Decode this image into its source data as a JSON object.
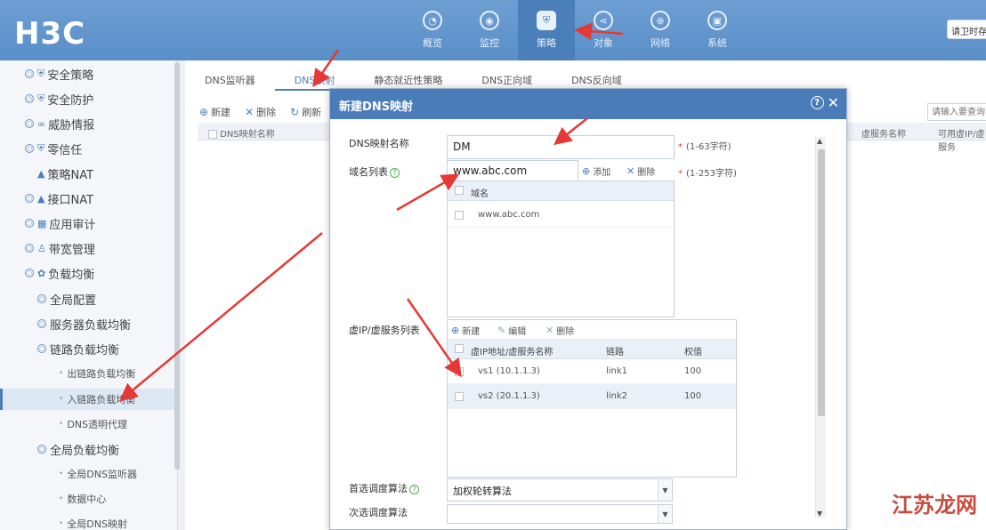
{
  "header": {
    "logo": "H3C",
    "nav": [
      {
        "label": "概览",
        "icon": "dashboard-icon",
        "glyph": "◔"
      },
      {
        "label": "监控",
        "icon": "monitor-icon",
        "glyph": "◉"
      },
      {
        "label": "策略",
        "icon": "shield-icon",
        "glyph": "⛨",
        "active": true
      },
      {
        "label": "对象",
        "icon": "share-icon",
        "glyph": "⋖"
      },
      {
        "label": "网络",
        "icon": "globe-icon",
        "glyph": "⊕"
      },
      {
        "label": "系统",
        "icon": "system-icon",
        "glyph": "▣"
      }
    ],
    "user_text": "请卫时存"
  },
  "sidebar": {
    "items": [
      {
        "label": "安全策略",
        "level": 0,
        "glyph": "⛨"
      },
      {
        "label": "安全防护",
        "level": 0,
        "glyph": "⛨"
      },
      {
        "label": "威胁情报",
        "level": 0,
        "glyph": "∞"
      },
      {
        "label": "零信任",
        "level": 0,
        "glyph": "⛨"
      },
      {
        "label": "策略NAT",
        "level": 1,
        "glyph": "▲"
      },
      {
        "label": "接口NAT",
        "level": 0,
        "glyph": "▲"
      },
      {
        "label": "应用审计",
        "level": 0,
        "glyph": "▦"
      },
      {
        "label": "带宽管理",
        "level": 0,
        "glyph": "♙"
      },
      {
        "label": "负载均衡",
        "level": 0,
        "glyph": "✿"
      },
      {
        "label": "全局配置",
        "level": 1
      },
      {
        "label": "服务器负载均衡",
        "level": 1
      },
      {
        "label": "链路负载均衡",
        "level": 1
      },
      {
        "label": "出链路负载均衡",
        "level": 2
      },
      {
        "label": "入链路负载均衡",
        "level": 2,
        "active": true
      },
      {
        "label": "DNS透明代理",
        "level": 2
      },
      {
        "label": "全局负载均衡",
        "level": 1
      },
      {
        "label": "全局DNS监听器",
        "level": 2
      },
      {
        "label": "数据中心",
        "level": 2
      },
      {
        "label": "全局DNS映射",
        "level": 2
      }
    ]
  },
  "main": {
    "tabs": [
      "DNS监听器",
      "DNS映射",
      "静态就近性策略",
      "DNS正向域",
      "DNS反向域"
    ],
    "active_tab": 1,
    "toolbar": {
      "add": "新建",
      "delete": "删除",
      "refresh": "刷新"
    },
    "grid_headers": [
      "DNS映射名称",
      "虚服务名称",
      "可用虚IP/虚服务"
    ],
    "search_placeholder": "请输入要查询"
  },
  "modal": {
    "title": "新建DNS映射",
    "name_label": "DNS映射名称",
    "name_value": "DM",
    "name_hint": "(1-63字符)",
    "domain_label": "域名列表",
    "domain_value": "www.abc.com",
    "domain_add": "添加",
    "domain_delete": "删除",
    "domain_hint": "(1-253字符)",
    "domain_col": "域名",
    "domains": [
      "www.abc.com"
    ],
    "vs_label": "虚IP/虚服务列表",
    "vs_toolbar": {
      "add": "新建",
      "edit": "编辑",
      "delete": "删除"
    },
    "vs_headers": [
      "虚IP地址/虚服务名称",
      "链路",
      "权值"
    ],
    "vs_rows": [
      {
        "name": "vs1 (10.1.1.3)",
        "link": "link1",
        "weight": "100"
      },
      {
        "name": "vs2 (20.1.1.3)",
        "link": "link2",
        "weight": "100"
      }
    ],
    "primary_label": "首选调度算法",
    "primary_value": "加权轮转算法",
    "secondary_label": "次选调度算法",
    "secondary_value": ""
  },
  "watermark": "江苏龙网",
  "colors": {
    "accent": "#4a7cb9",
    "arrow": "#e53935"
  }
}
